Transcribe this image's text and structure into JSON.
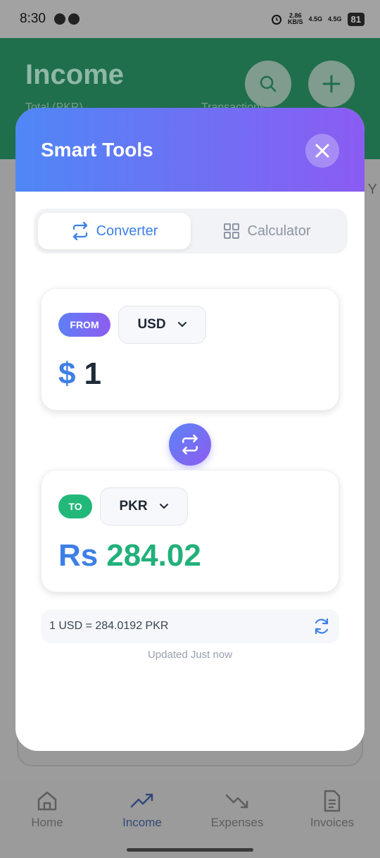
{
  "status_bar": {
    "time": "8:30",
    "speed_top": "2.86",
    "speed_bottom": "KB/S",
    "net1": "4.5G",
    "net2": "4.5G",
    "battery": "81"
  },
  "background": {
    "title": "Income",
    "subtitle_left": "Total (PKR)",
    "subtitle_right": "Transactions",
    "edge_text": "Y"
  },
  "bottom_nav": {
    "items": [
      {
        "label": "Home",
        "icon": "home-icon"
      },
      {
        "label": "Income",
        "icon": "trending-up-icon",
        "active": true
      },
      {
        "label": "Expenses",
        "icon": "trending-down-icon"
      },
      {
        "label": "Invoices",
        "icon": "document-icon"
      }
    ]
  },
  "modal": {
    "title": "Smart Tools",
    "tabs": [
      {
        "label": "Converter",
        "icon": "swap-icon",
        "active": true
      },
      {
        "label": "Calculator",
        "icon": "grid-icon"
      }
    ],
    "from": {
      "badge": "FROM",
      "currency": "USD",
      "symbol": "$",
      "amount": "1"
    },
    "to": {
      "badge": "TO",
      "currency": "PKR",
      "symbol": "Rs",
      "amount": "284.02"
    },
    "rate_text": "1 USD = 284.0192 PKR",
    "updated_text": "Updated Just now"
  },
  "colors": {
    "accent_blue": "#3d7fe6",
    "accent_purple": "#8b5cf2",
    "accent_green": "#22b07a"
  }
}
